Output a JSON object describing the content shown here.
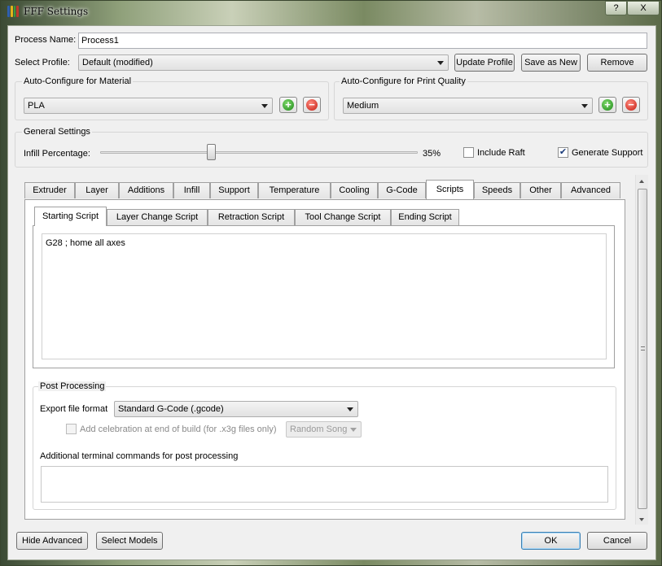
{
  "window": {
    "title": "FFF Settings",
    "help_label": "?",
    "close_label": "X"
  },
  "process": {
    "name_label": "Process Name:",
    "name_value": "Process1",
    "profile_label": "Select Profile:",
    "profile_value": "Default (modified)",
    "update_profile": "Update Profile",
    "save_as_new": "Save as New",
    "remove": "Remove"
  },
  "material": {
    "group_title": "Auto-Configure for Material",
    "value": "PLA"
  },
  "quality": {
    "group_title": "Auto-Configure for Print Quality",
    "value": "Medium"
  },
  "general": {
    "group_title": "General Settings",
    "infill_label": "Infill Percentage:",
    "infill_value": "35%",
    "infill_fraction": 0.35,
    "include_raft_label": "Include Raft",
    "include_raft_checked": false,
    "generate_support_label": "Generate Support",
    "generate_support_checked": true
  },
  "tabs": [
    {
      "label": "Extruder"
    },
    {
      "label": "Layer"
    },
    {
      "label": "Additions"
    },
    {
      "label": "Infill"
    },
    {
      "label": "Support"
    },
    {
      "label": "Temperature"
    },
    {
      "label": "Cooling"
    },
    {
      "label": "G-Code"
    },
    {
      "label": "Scripts",
      "active": true
    },
    {
      "label": "Speeds"
    },
    {
      "label": "Other"
    },
    {
      "label": "Advanced"
    }
  ],
  "script_tabs": [
    {
      "label": "Starting Script",
      "active": true
    },
    {
      "label": "Layer Change Script"
    },
    {
      "label": "Retraction Script"
    },
    {
      "label": "Tool Change Script"
    },
    {
      "label": "Ending Script"
    }
  ],
  "script_text": "G28 ; home all axes",
  "post_processing": {
    "group_title": "Post Processing",
    "export_label": "Export file format",
    "export_value": "Standard G-Code (.gcode)",
    "celebration_label": "Add celebration at end of build (for .x3g files only)",
    "celebration_checked": false,
    "song_value": "Random Song",
    "additional_label": "Additional terminal commands for post processing",
    "additional_value": ""
  },
  "footer": {
    "hide_advanced": "Hide Advanced",
    "select_models": "Select Models",
    "ok": "OK",
    "cancel": "Cancel"
  },
  "icons": {
    "app_icon_colors": [
      "#2f5fae",
      "#e0b21c",
      "#3c9b3a",
      "#c0392b"
    ]
  }
}
